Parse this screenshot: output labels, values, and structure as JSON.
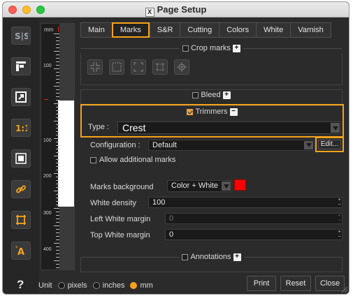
{
  "window": {
    "title": "Page Setup"
  },
  "tabs": [
    "Main",
    "Marks",
    "S&R",
    "Cutting",
    "Colors",
    "White",
    "Varnish"
  ],
  "active_tab": "Marks",
  "ruler": {
    "unit": "mm",
    "labels": [
      "100",
      "100",
      "200",
      "300",
      "400"
    ]
  },
  "sections": {
    "crop_marks": "Crop marks",
    "bleed": "Bleed",
    "trimmers": "Trimmers",
    "annotations": "Annotations"
  },
  "trimmers": {
    "type_label": "Type",
    "type_value": "Crest",
    "configuration_label": "Configuration",
    "configuration_value": "Default",
    "edit_label": "Edit...",
    "allow_additional": "Allow additional marks",
    "marks_background_label": "Marks background",
    "marks_background_value": "Color + White",
    "marks_background_color": "#ff0000",
    "white_density_label": "White density",
    "white_density_value": "100",
    "left_white_margin_label": "Left White margin",
    "left_white_margin_value": "0",
    "top_white_margin_label": "Top White margin",
    "top_white_margin_value": "0"
  },
  "bottom": {
    "unit_label": "Unit",
    "units": [
      "pixels",
      "inches",
      "mm"
    ],
    "selected_unit": "mm",
    "print": "Print",
    "reset": "Reset",
    "close": "Close",
    "help": "?"
  },
  "sidebar_icons": [
    "split-view-icon",
    "layout-icon",
    "export-icon",
    "actual-size-icon",
    "fit-page-icon",
    "link-icon",
    "marks-icon",
    "text-annotation-icon"
  ],
  "colors": {
    "accent": "#f5a21b",
    "panel": "#2b2b2b",
    "field": "#1a1a1a"
  }
}
